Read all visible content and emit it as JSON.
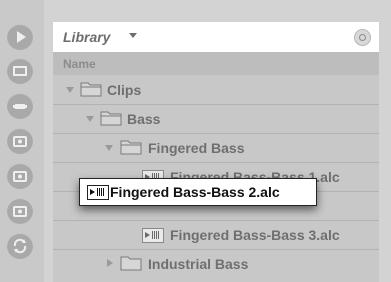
{
  "sidebar": {
    "icons": [
      "play-icon",
      "window-icon",
      "plug-icon",
      "camera-icon-1",
      "camera-icon-2",
      "camera-icon-3",
      "refresh-icon"
    ]
  },
  "browser": {
    "title": "Library",
    "column_header": "Name",
    "rows": [
      {
        "label": "Clips",
        "kind": "folder",
        "state": "expanded"
      },
      {
        "label": "Bass",
        "kind": "folder",
        "state": "expanded"
      },
      {
        "label": "Fingered Bass",
        "kind": "folder",
        "state": "expanded"
      },
      {
        "label": "Fingered Bass-Bass 1.alc",
        "kind": "clip"
      },
      {
        "label": "Fingered Bass-Bass 2.alc",
        "kind": "clip",
        "selected": true
      },
      {
        "label": "Fingered Bass-Bass 3.alc",
        "kind": "clip"
      },
      {
        "label": "Industrial Bass",
        "kind": "folder",
        "state": "collapsed"
      }
    ]
  },
  "colors": {
    "panel_bg": "#c8c8c8",
    "header_bg": "#ffffff",
    "selected_border": "#222222"
  }
}
